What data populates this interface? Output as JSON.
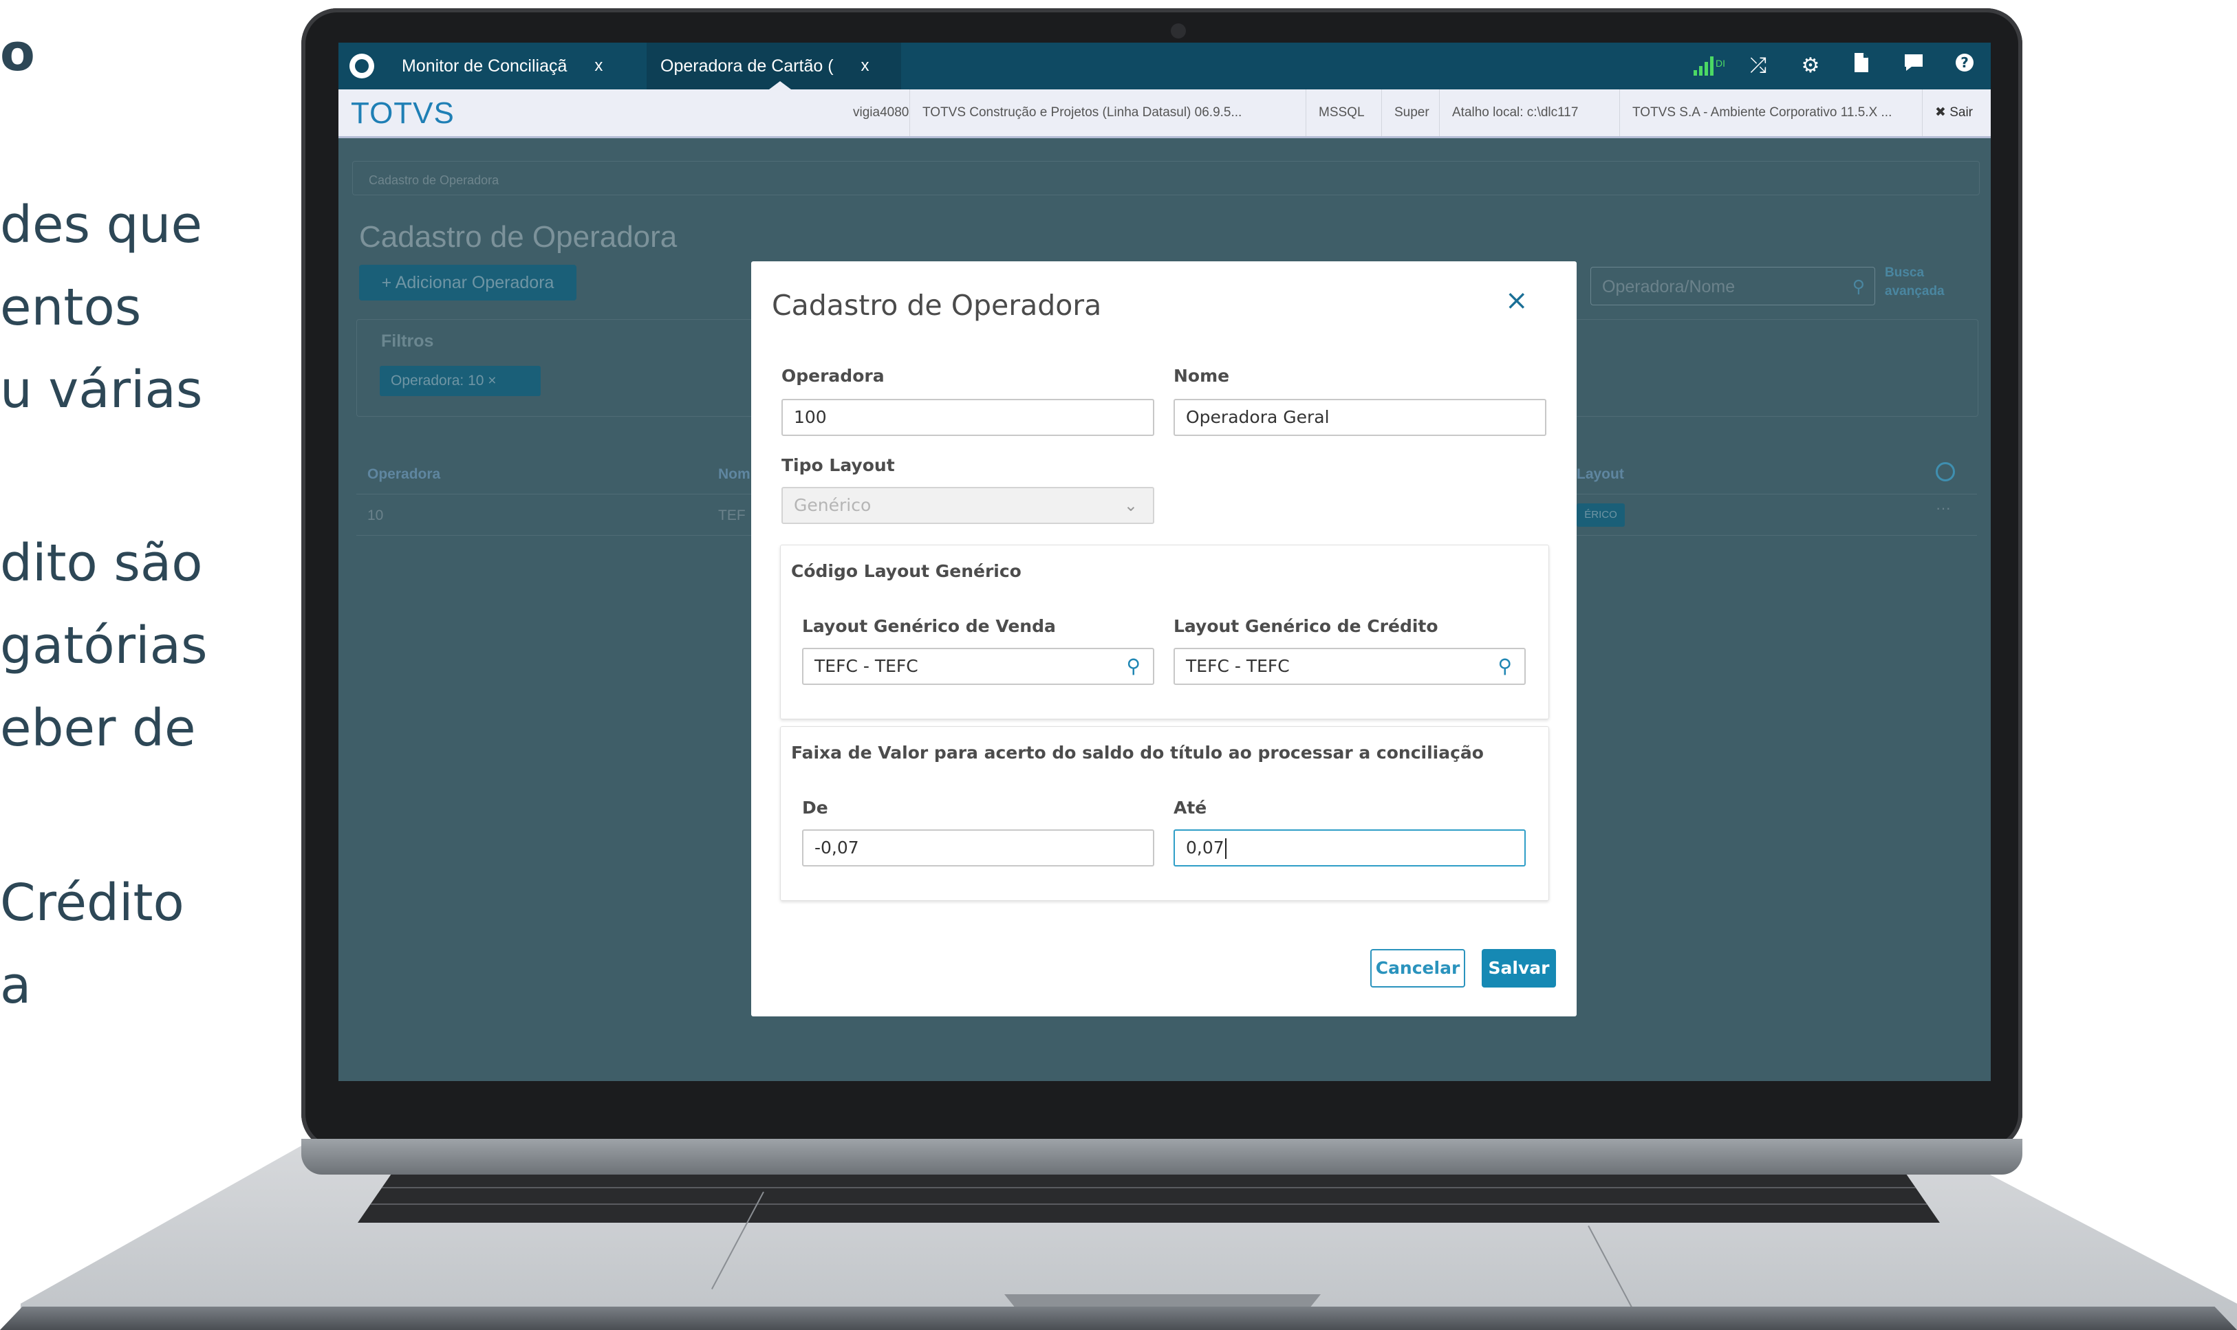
{
  "slide_text": {
    "line1": "o",
    "line2": "des que",
    "line3": "entos",
    "line4": "u várias",
    "line5": "dito  são",
    "line6": "gatórias",
    "line7": "eber   de",
    "line8": "Crédito",
    "line9": "a"
  },
  "topbar": {
    "tabs": [
      {
        "label": "Monitor de Conciliaçã",
        "close": "x"
      },
      {
        "label": "Operadora de Cartão (",
        "close": "x"
      }
    ],
    "network_label": "DI",
    "icons": [
      "signal-icon",
      "shuffle-icon",
      "gear-icon",
      "document-icon",
      "chat-icon",
      "help-icon"
    ]
  },
  "infobar": {
    "brand": "TOTVS",
    "items": [
      "vigia4080",
      "TOTVS Construção e Projetos (Linha Datasul) 06.9.5...",
      "MSSQL",
      "Super",
      "Atalho local: c:\\dlc117",
      "TOTVS S.A - Ambiente Corporativo 11.5.X ..."
    ],
    "logout_label": "✖ Sair"
  },
  "background_page": {
    "breadcrumb": "Cadastro de Operadora",
    "title": "Cadastro de Operadora",
    "add_button": "+ Adicionar Operadora",
    "search_placeholder": "Operadora/Nome",
    "advanced_search_line1": "Busca",
    "advanced_search_line2": "avançada",
    "filters_title": "Filtros",
    "filter_chip": "Operadora: 10   ×",
    "columns": [
      "Operadora",
      "Nom",
      "Layout"
    ],
    "row": {
      "operadora": "10",
      "nome": "TEF",
      "layout": "ÉRICO"
    },
    "row_actions": "···"
  },
  "modal": {
    "title": "Cadastro de Operadora",
    "close": "×",
    "operadora_label": "Operadora",
    "operadora_value": "100",
    "nome_label": "Nome",
    "nome_value": "Operadora Geral",
    "tipo_layout_label": "Tipo Layout",
    "tipo_layout_value": "Genérico",
    "codigo_section_title": "Código Layout Genérico",
    "layout_venda_label": "Layout Genérico de Venda",
    "layout_venda_value": "TEFC - TEFC",
    "layout_credito_label": "Layout Genérico de Crédito",
    "layout_credito_value": "TEFC - TEFC",
    "faixa_section_title": "Faixa de Valor para acerto do saldo do título ao processar a conciliação",
    "de_label": "De",
    "de_value": "-0,07",
    "ate_label": "Até",
    "ate_value": "0,07",
    "cancel_button": "Cancelar",
    "save_button": "Salvar"
  },
  "colors": {
    "topbar": "#0f4a63",
    "overlay": "#3f5e68",
    "primary": "#1689b4",
    "brand": "#1f7fb5"
  }
}
